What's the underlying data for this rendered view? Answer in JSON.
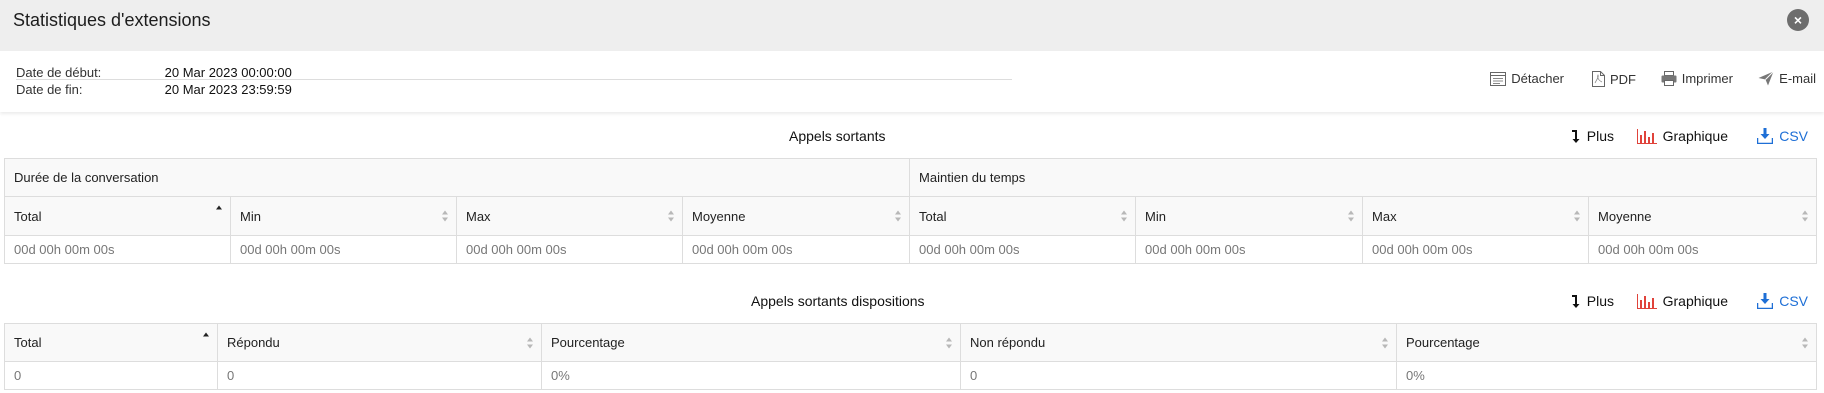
{
  "window": {
    "title": "Statistiques d'extensions",
    "close_icon": "×"
  },
  "dates": {
    "start_label": "Date de début:",
    "start_value": "20 Mar 2023 00:00:00",
    "end_label": "Date de fin:",
    "end_value": "20 Mar 2023 23:59:59"
  },
  "actions": {
    "detach": "Détacher",
    "pdf": "PDF",
    "print": "Imprimer",
    "email": "E-mail"
  },
  "section1": {
    "title": "Appels sortants",
    "tools": {
      "more": "Plus",
      "chart": "Graphique",
      "csv": "CSV"
    },
    "groups": [
      "Durée de la conversation",
      "Maintien du temps"
    ],
    "columns": [
      "Total",
      "Min",
      "Max",
      "Moyenne",
      "Total",
      "Min",
      "Max",
      "Moyenne"
    ],
    "row": [
      "00d 00h 00m 00s",
      "00d 00h 00m 00s",
      "00d 00h 00m 00s",
      "00d 00h 00m 00s",
      "00d 00h 00m 00s",
      "00d 00h 00m 00s",
      "00d 00h 00m 00s",
      "00d 00h 00m 00s"
    ]
  },
  "section2": {
    "title": "Appels sortants dispositions",
    "tools": {
      "more": "Plus",
      "chart": "Graphique",
      "csv": "CSV"
    },
    "columns": [
      "Total",
      "Répondu",
      "Pourcentage",
      "Non répondu",
      "Pourcentage"
    ],
    "row": [
      "0",
      "0",
      "0%",
      "0",
      "0%"
    ]
  },
  "colors": {
    "accent": "#1e6fd6",
    "chart_icon": "#e0433b",
    "header_bg": "#eeeeee"
  }
}
